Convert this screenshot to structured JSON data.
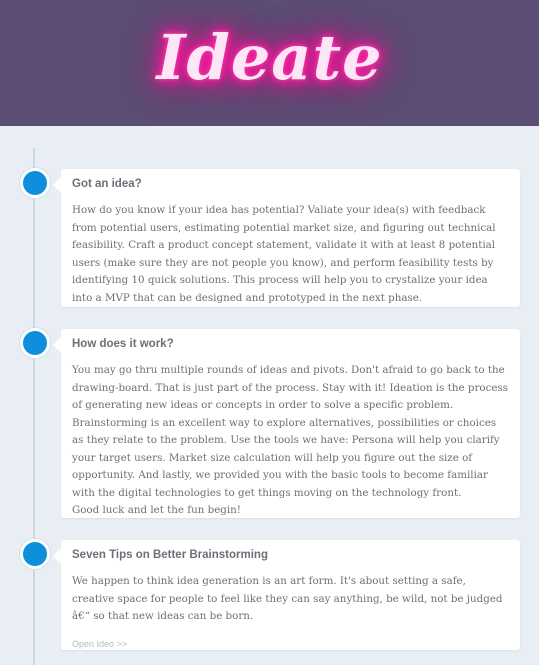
{
  "header": {
    "logo_text": "Ideate"
  },
  "cards": [
    {
      "title": "Got an idea?",
      "body": "How do you know if your idea has potential? Valiate your idea(s) with feedback from potential users, estimating potential market size, and figuring out technical feasibility. Craft a product concept statement, validate it with at least 8 potential users (make sure they are not people you know), and perform feasibility tests by identifying 10 quick solutions. This process will help you to crystalize your idea into a MVP that can be designed and prototyped in the next phase."
    },
    {
      "title": "How does it work?",
      "body": "You may go thru multiple rounds of ideas and pivots. Don't afraid to go back to the drawing-board. That is just part of the process. Stay with it! Ideation is the process of generating new ideas or concepts in order to solve a specific problem. Brainstorming is an excellent way to explore alternatives, possibilities or choices as they relate to the problem. Use the tools we have: Persona will help you clarify your target users. Market size calculation will help you figure out the size of opportunity. And lastly, we provided you with the basic tools to become familiar with the digital technologies to get things moving on the technology front.",
      "body2": "Good luck and let the fun begin!"
    },
    {
      "title": "Seven Tips on Better Brainstorming",
      "body": "We happen to think idea generation is an art form. It's about setting a safe, creative space for people to feel like they can say anything, be wild, not be judged â€“ so that new ideas can be born.",
      "link": "Open Ideo >>"
    }
  ],
  "colors": {
    "header_bg": "#5b4d73",
    "logo_glow": "#ff1aa0",
    "accent_dot": "#0d8fdb",
    "page_bg": "#e8eef4"
  }
}
